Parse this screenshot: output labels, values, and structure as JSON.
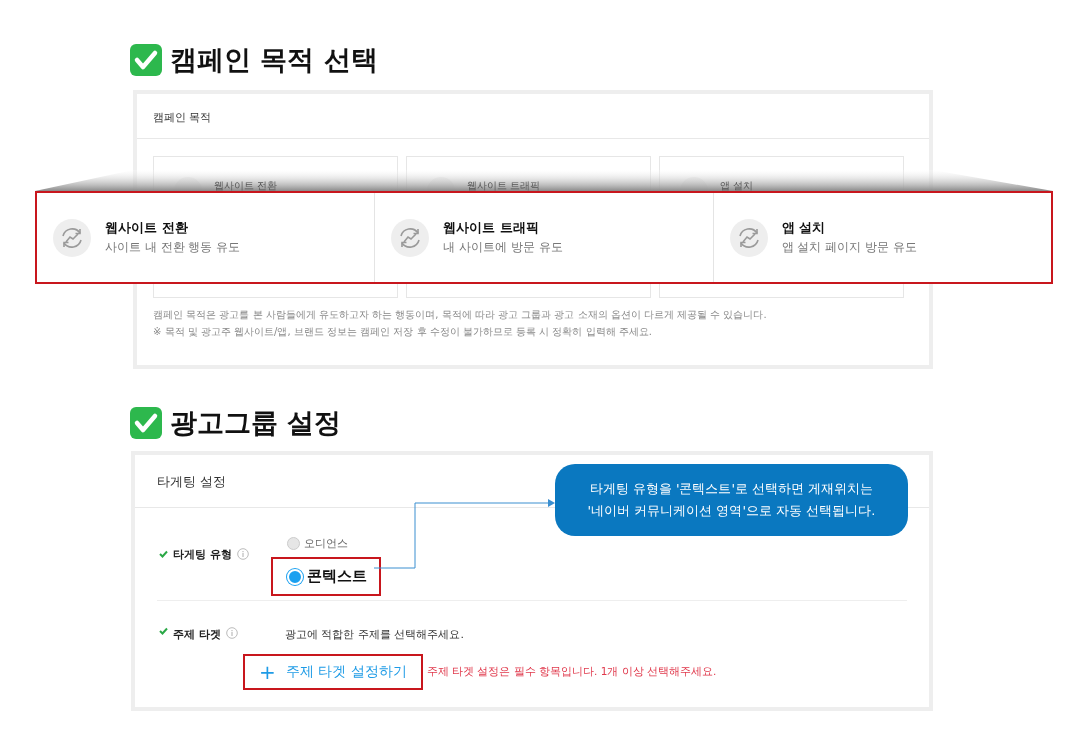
{
  "sections": [
    {
      "title": "캠페인 목적 선택"
    },
    {
      "title": "광고그룹 설정"
    }
  ],
  "campaign_panel": {
    "header": "캠페인 목적",
    "background_cards": [
      {
        "title": "웹사이트 전환"
      },
      {
        "title": "웹사이트 트래픽"
      },
      {
        "title": "앱 설치"
      }
    ],
    "cards": [
      {
        "title": "웹사이트 전환",
        "subtitle": "사이트 내 전환 행동 유도"
      },
      {
        "title": "웹사이트 트래픽",
        "subtitle": "내 사이트에 방문 유도"
      },
      {
        "title": "앱 설치",
        "subtitle": "앱 설치 페이지 방문 유도"
      }
    ],
    "notes": [
      "캠페인 목적은 광고를 본 사람들에게 유도하고자 하는 행동이며, 목적에 따라 광고 그룹과 광고 소재의 옵션이 다르게 제공될 수 있습니다.",
      "※ 목적 및 광고주 웹사이트/앱, 브랜드 정보는 캠페인 저장 후 수정이 불가하므로 등록 시 정확히 입력해 주세요."
    ]
  },
  "targeting_panel": {
    "header": "타게팅 설정",
    "type_row": {
      "label": "타게팅 유형",
      "options": [
        {
          "label": "오디언스",
          "selected": false,
          "disabled": true
        },
        {
          "label": "콘텍스트",
          "selected": true,
          "disabled": false
        }
      ]
    },
    "topic_row": {
      "label": "주제 타겟",
      "hint": "광고에 적합한 주제를 선택해주세요.",
      "button": "주제 타겟 설정하기",
      "button_icon": "+",
      "error": "주제 타겟 설정은 필수 항목입니다. 1개 이상 선택해주세요."
    },
    "callout": [
      "타게팅 유형을 '콘텍스트'로 선택하면 게재위치는",
      "'네이버 커뮤니케이션 영역'으로 자동 선택됩니다."
    ]
  }
}
